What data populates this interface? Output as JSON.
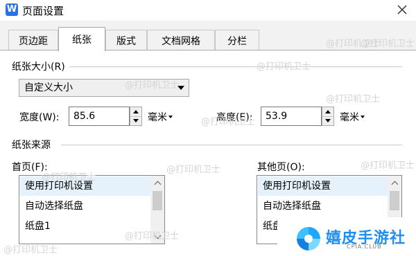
{
  "window": {
    "title": "页面设置",
    "app_icon_letter": "W"
  },
  "tabs": [
    {
      "label": "页边距"
    },
    {
      "label": "纸张",
      "active": true
    },
    {
      "label": "版式"
    },
    {
      "label": "文档网格"
    },
    {
      "label": "分栏"
    }
  ],
  "paper_size": {
    "group_title": "纸张大小(R)",
    "selected": "自定义大小",
    "width_label": "宽度(W):",
    "width_value": "85.6",
    "width_unit": "毫米",
    "height_label": "高度(E):",
    "height_value": "53.9",
    "height_unit": "毫米"
  },
  "paper_source": {
    "group_title": "纸张来源",
    "first_page_label": "首页(F):",
    "first_page_items": [
      "使用打印机设置",
      "自动选择纸盘",
      "纸盘1"
    ],
    "other_pages_label": "其他页(O):",
    "other_pages_items": [
      "使用打印机设置",
      "自动选择纸盘",
      "纸盘1"
    ]
  },
  "watermark": "@打印机卫士",
  "brand": {
    "name": "嬉皮手游社",
    "sub": "CPIA.CLUB"
  },
  "colors": {
    "accent": "#2f6fe4",
    "selected": "#e5f1fb",
    "brand": "#1e8ff0"
  }
}
